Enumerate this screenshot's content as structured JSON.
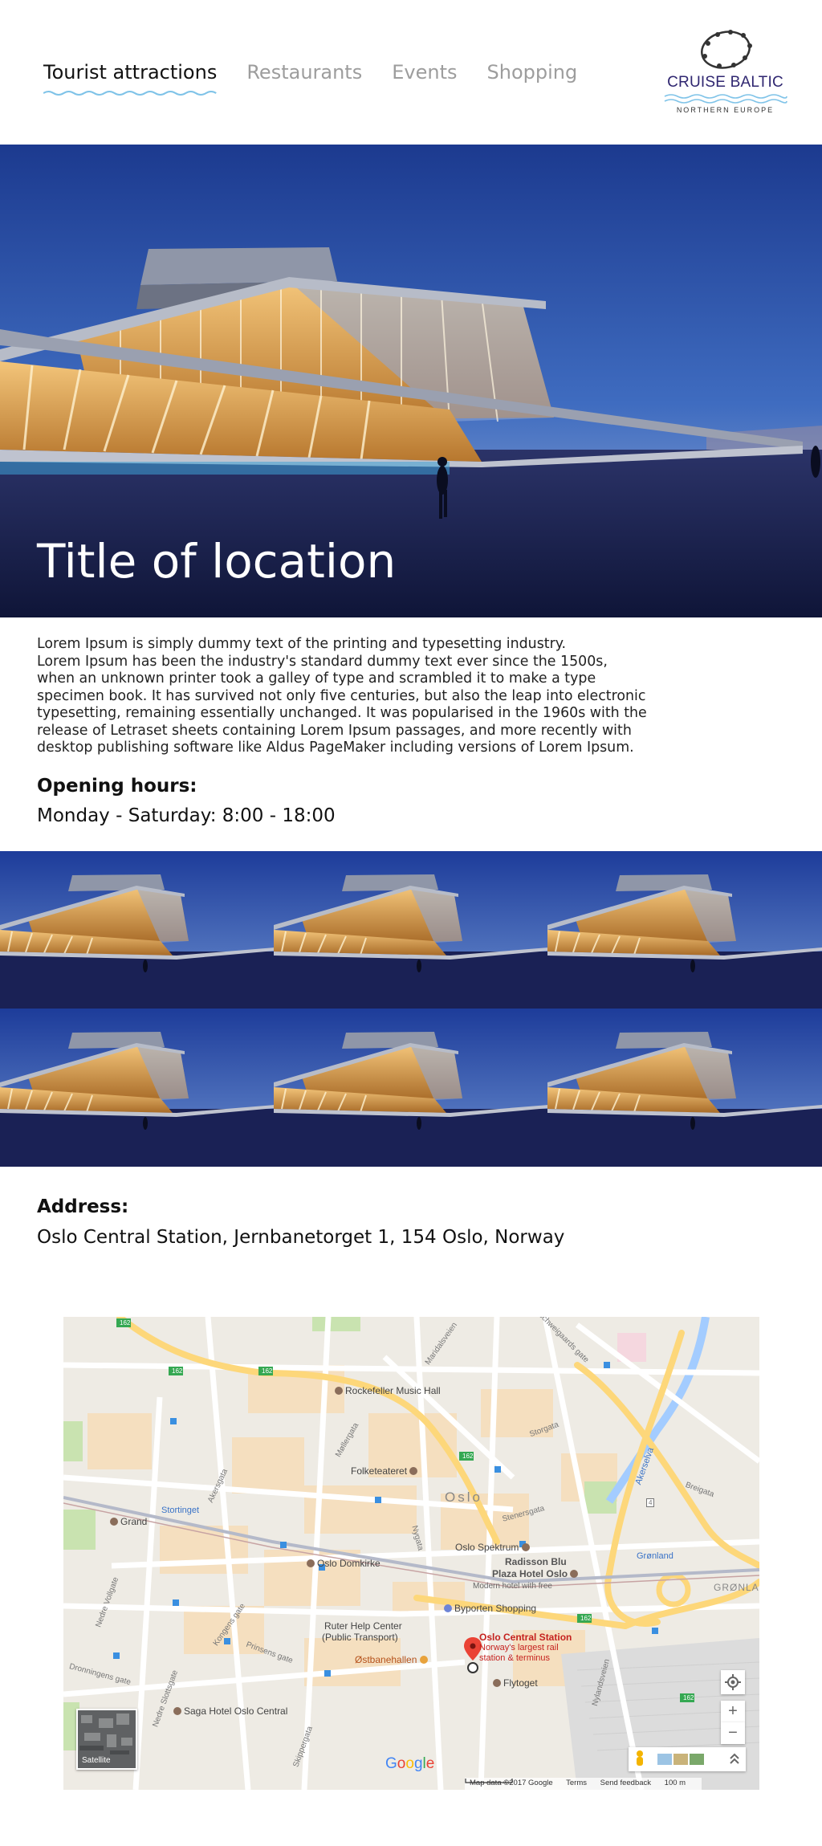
{
  "nav": {
    "items": [
      "Tourist attractions",
      "Restaurants",
      "Events",
      "Shopping"
    ],
    "active_index": 0
  },
  "logo": {
    "name": "CRUISE BALTIC",
    "subtitle": "NORTHERN EUROPE"
  },
  "hero": {
    "title": "Title of location"
  },
  "description": "Lorem Ipsum is simply dummy text of the printing and typesetting industry.\nLorem Ipsum has been the industry's standard dummy text ever since the 1500s,\n when an unknown printer took a galley of type and scrambled it to make a type\n specimen book. It has survived not only five centuries, but also the leap into electronic\ntypesetting, remaining essentially unchanged. It was popularised in the 1960s with the\nrelease of Letraset sheets containing Lorem Ipsum passages, and more recently with\ndesktop publishing software like Aldus PageMaker including versions of Lorem Ipsum.",
  "opening_hours": {
    "label": "Opening hours:",
    "value": "Monday - Saturday: 8:00 - 18:00"
  },
  "gallery": {
    "count": 6
  },
  "address": {
    "label": "Address:",
    "value": "Oslo Central Station, Jernbanetorget 1, 154 Oslo, Norway"
  },
  "map": {
    "city_label": "Oslo",
    "marker": {
      "title": "Oslo Central Station",
      "desc_line1": "Norway's largest rail",
      "desc_line2": "station & terminus"
    },
    "places": {
      "rockefeller": "Rockefeller Music Hall",
      "folketeateret": "Folketeateret",
      "grand": "Grand",
      "stortinget": "Stortinget",
      "domkirke": "Oslo Domkirke",
      "spektrum": "Oslo Spektrum",
      "radisson1": "Radisson Blu",
      "radisson2": "Plaza Hotel Oslo",
      "modern_hotel": "Modern hotel with free",
      "byporten": "Byporten Shopping",
      "ruter1": "Ruter Help Center",
      "ruter2": "(Public Transport)",
      "ostbanehallen": "Østbanehallen",
      "flytoget": "Flytoget",
      "saga": "Saga Hotel Oslo Central",
      "gronland": "Grønland",
      "gronland_caps": "GRØNLA",
      "akerselva": "Akerselva"
    },
    "roads": {
      "maridals": "Maridalsveien",
      "mollergata": "Møllergata",
      "storgata": "Storgata",
      "akersgata": "Akersgata",
      "nygata": "Nygata",
      "stenersgata": "Stenersgata",
      "kongens": "Kongens gate",
      "prinsens": "Prinsens gate",
      "nedre_vollgate": "Nedre Vollgate",
      "nedre_slottsgate": "Nedre Slottsgate",
      "skippergata": "Skippergata",
      "nylandsveien": "Nylandsveien",
      "breigata": "Breigata",
      "schweigaards": "Schweigaards gate",
      "dronningens": "Dronningens gate",
      "route162": "162",
      "route4": "4"
    },
    "satellite_label": "Satellite",
    "google_letters": [
      "G",
      "o",
      "o",
      "g",
      "l",
      "e"
    ],
    "google_colors": [
      "#4285f4",
      "#ea4335",
      "#fbbc05",
      "#4285f4",
      "#34a853",
      "#ea4335"
    ],
    "footer": {
      "data": "Map data ©2017 Google",
      "terms": "Terms",
      "feedback": "Send feedback",
      "scale": "100 m"
    },
    "zoom_in": "+",
    "zoom_out": "−"
  },
  "colors": {
    "nav_active": "#111111",
    "nav_inactive": "#9d9d9d",
    "wave": "#7fc3e8",
    "logo": "#2f2670",
    "sky_top": "#1c3a8f",
    "sky_bottom": "#5d86c9"
  }
}
